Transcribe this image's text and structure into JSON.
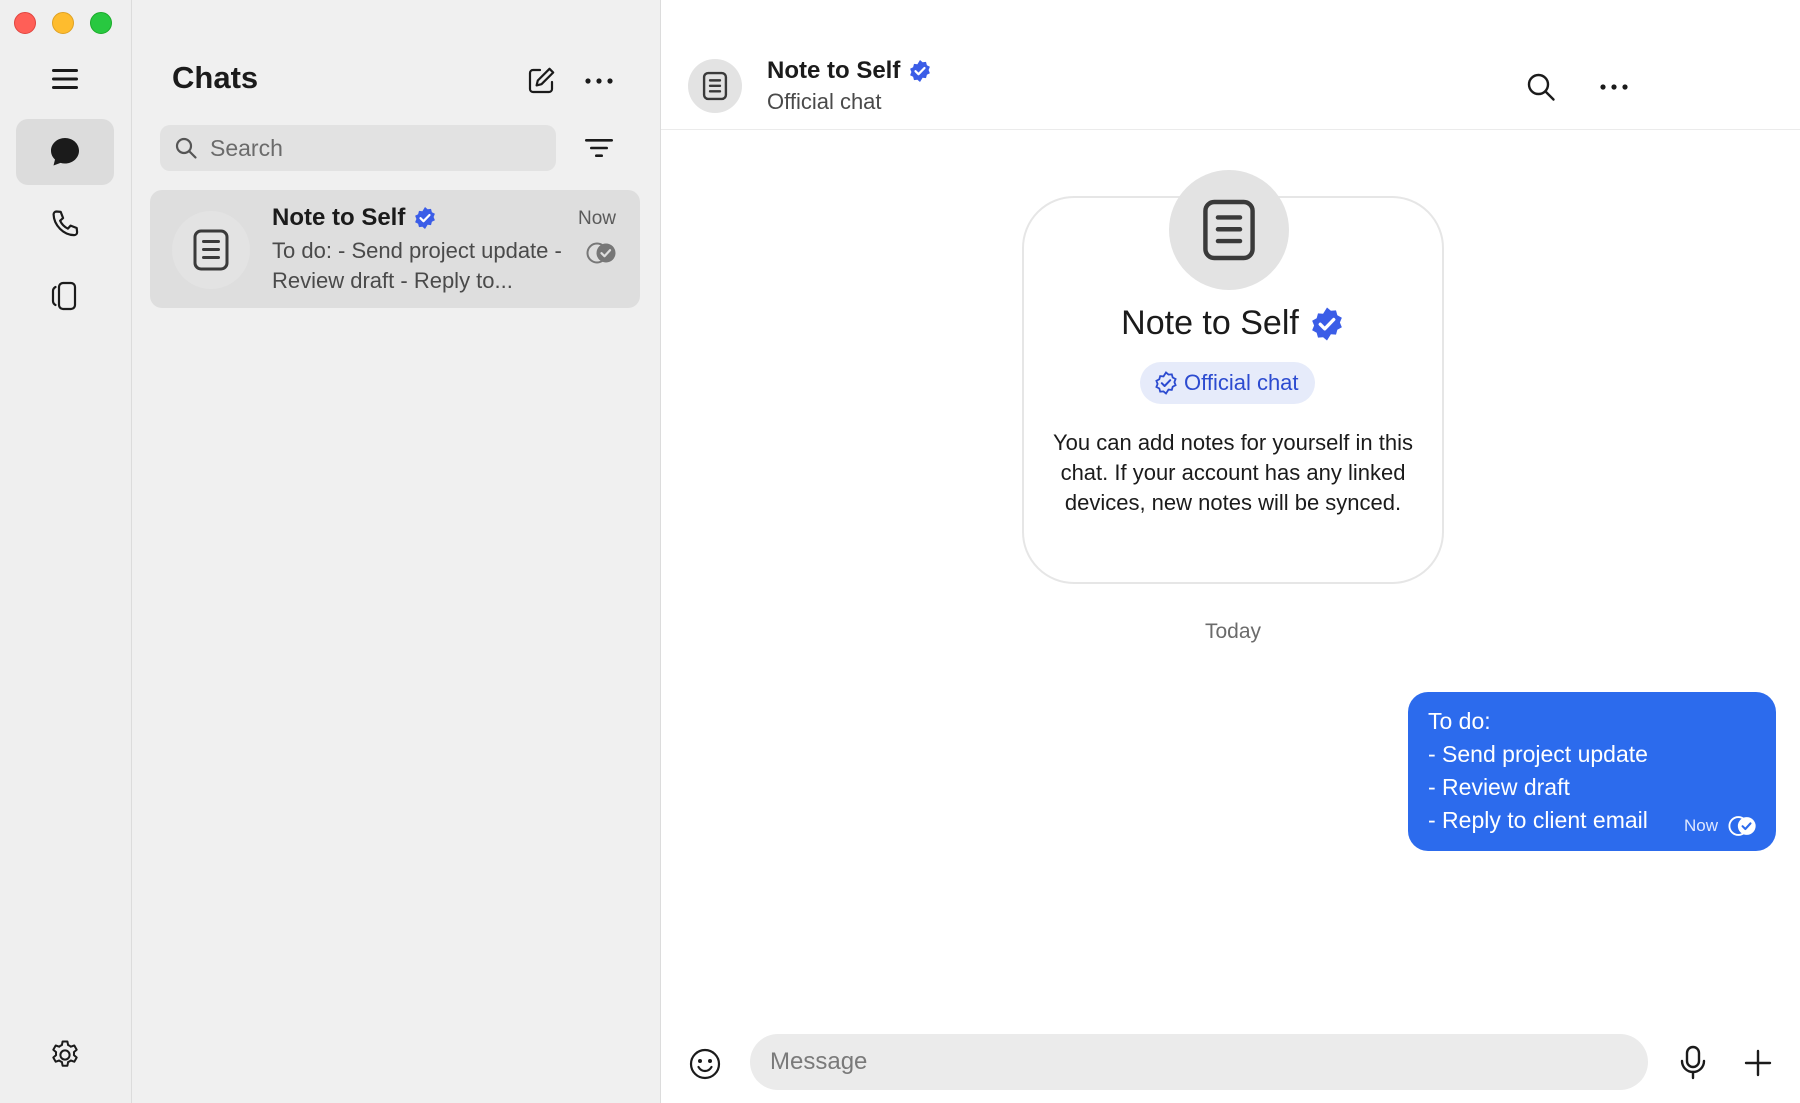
{
  "colors": {
    "accent": "#2c6bed",
    "verified": "#3b5de7",
    "rail_bg": "#efefef",
    "list_bg": "#f0f0f0",
    "selected_row": "#dedede"
  },
  "icons": {
    "window_controls": [
      "close-icon",
      "minimize-icon",
      "maximize-icon"
    ],
    "rail": [
      "menu-icon",
      "chat-bubble-icon",
      "phone-icon",
      "stories-icon",
      "gear-icon"
    ],
    "list_header": [
      "compose-icon",
      "more-icon"
    ],
    "search": "search-icon",
    "filter": "filter-icon",
    "avatar": "note-icon",
    "verified": "verified-badge-icon",
    "receipt": "read-receipt-icon",
    "composer": [
      "emoji-icon",
      "microphone-icon",
      "plus-icon"
    ]
  },
  "chat_list": {
    "title": "Chats",
    "search_placeholder": "Search",
    "items": [
      {
        "name": "Note to Self",
        "time": "Now",
        "preview": "To do: - Send project update - Review draft - Reply to..."
      }
    ]
  },
  "conversation": {
    "header": {
      "name": "Note to Self",
      "subtitle": "Official chat"
    },
    "intro": {
      "name": "Note to Self",
      "badge": "Official chat",
      "description": "You can add notes for yourself in this chat. If your account has any linked devices, new notes will be synced."
    },
    "date_separator": "Today",
    "messages": [
      {
        "text": "To do:\n- Send project update\n- Review draft\n- Reply to client email",
        "time": "Now"
      }
    ],
    "composer": {
      "placeholder": "Message"
    }
  }
}
